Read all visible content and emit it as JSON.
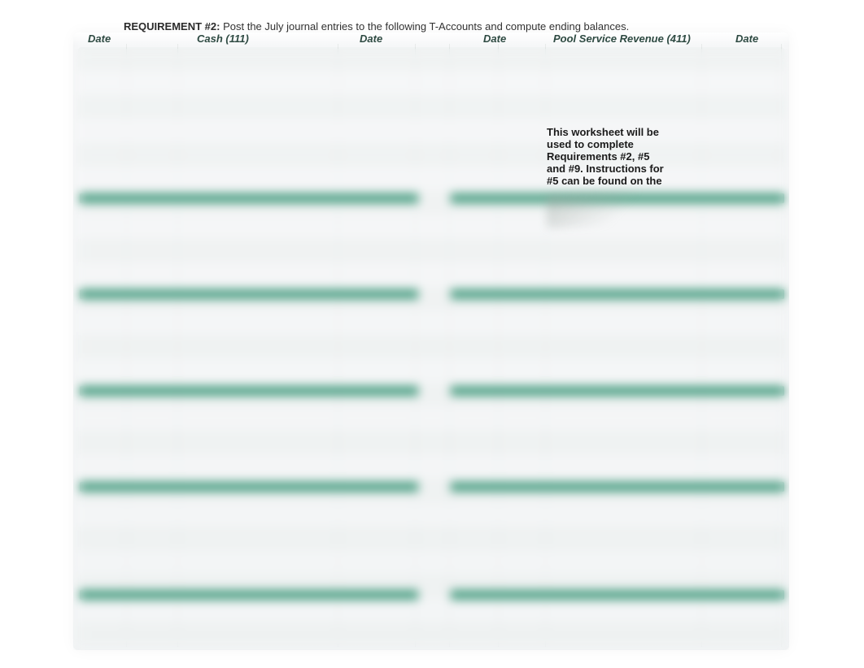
{
  "instruction": {
    "label": "REQUIREMENT #2:",
    "text": " Post the July journal entries to the following T-Accounts and compute ending balances."
  },
  "headers": {
    "left_date": "Date",
    "left_account": "Cash (111)",
    "left_date_right": "Date",
    "right_date": "Date",
    "right_account": "Pool Service Revenue (411)",
    "right_date_right": "Date"
  },
  "note": {
    "line1": "This worksheet will be",
    "line2": "used to complete",
    "line3": "Requirements #2, #5",
    "line4": "and #9. Instructions for",
    "line5": "#5 can be found on the"
  }
}
